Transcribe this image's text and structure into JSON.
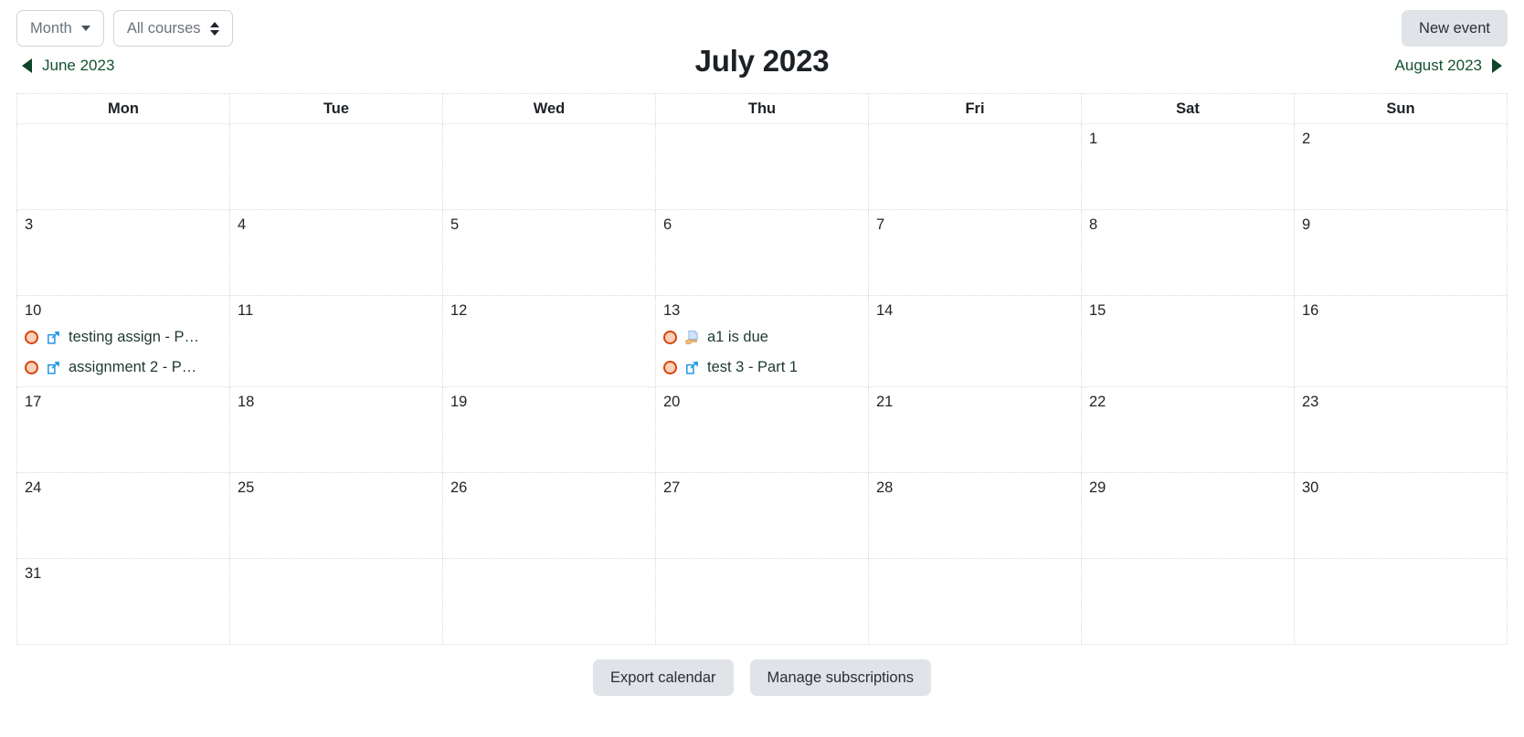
{
  "toolbar": {
    "view_select": "Month",
    "course_select": "All courses",
    "new_event": "New event"
  },
  "nav": {
    "prev_label": "June 2023",
    "next_label": "August 2023",
    "current_month": "July 2023"
  },
  "calendar": {
    "weekday_headers": [
      "Mon",
      "Tue",
      "Wed",
      "Thu",
      "Fri",
      "Sat",
      "Sun"
    ],
    "weeks": [
      [
        {
          "day": ""
        },
        {
          "day": ""
        },
        {
          "day": ""
        },
        {
          "day": ""
        },
        {
          "day": ""
        },
        {
          "day": "1"
        },
        {
          "day": "2"
        }
      ],
      [
        {
          "day": "3"
        },
        {
          "day": "4"
        },
        {
          "day": "5"
        },
        {
          "day": "6"
        },
        {
          "day": "7"
        },
        {
          "day": "8"
        },
        {
          "day": "9"
        }
      ],
      [
        {
          "day": "10",
          "events": [
            {
              "title": "testing assign - P…",
              "icon": "assignment-link-icon"
            },
            {
              "title": "assignment 2 - P…",
              "icon": "assignment-link-icon"
            }
          ]
        },
        {
          "day": "11"
        },
        {
          "day": "12"
        },
        {
          "day": "13",
          "events": [
            {
              "title": "a1 is due",
              "icon": "assignment-submit-icon"
            },
            {
              "title": "test 3 - Part 1",
              "icon": "assignment-link-icon"
            }
          ]
        },
        {
          "day": "14"
        },
        {
          "day": "15"
        },
        {
          "day": "16"
        }
      ],
      [
        {
          "day": "17"
        },
        {
          "day": "18"
        },
        {
          "day": "19"
        },
        {
          "day": "20"
        },
        {
          "day": "21"
        },
        {
          "day": "22"
        },
        {
          "day": "23"
        }
      ],
      [
        {
          "day": "24"
        },
        {
          "day": "25"
        },
        {
          "day": "26"
        },
        {
          "day": "27"
        },
        {
          "day": "28"
        },
        {
          "day": "29"
        },
        {
          "day": "30"
        }
      ],
      [
        {
          "day": "31"
        },
        {
          "day": ""
        },
        {
          "day": ""
        },
        {
          "day": ""
        },
        {
          "day": ""
        },
        {
          "day": ""
        },
        {
          "day": ""
        }
      ]
    ]
  },
  "footer": {
    "export_calendar": "Export calendar",
    "manage_subscriptions": "Manage subscriptions"
  },
  "colors": {
    "event_marker": "#d6440b",
    "nav_link": "#14512f",
    "icon_blue": "#2196e3",
    "button_gray": "#e0e3e7"
  }
}
